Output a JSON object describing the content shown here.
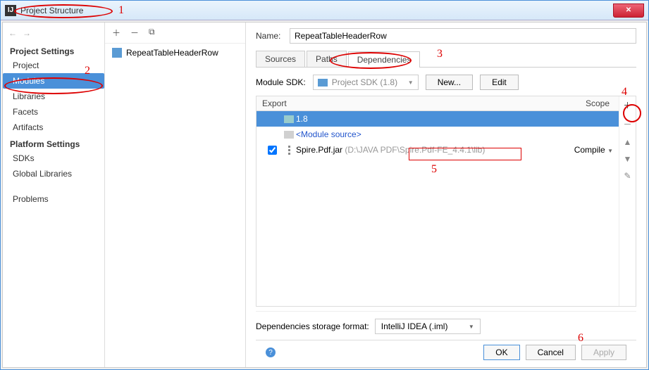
{
  "title": "Project Structure",
  "sidebar": {
    "heading1": "Project Settings",
    "items1": [
      "Project",
      "Modules",
      "Libraries",
      "Facets",
      "Artifacts"
    ],
    "heading2": "Platform Settings",
    "items2": [
      "SDKs",
      "Global Libraries"
    ],
    "footer": "Problems"
  },
  "module_name": "RepeatTableHeaderRow",
  "main": {
    "name_label": "Name:",
    "name_value": "RepeatTableHeaderRow",
    "tabs": [
      "Sources",
      "Paths",
      "Dependencies"
    ],
    "sdk_label": "Module SDK:",
    "sdk_value": "Project SDK (1.8)",
    "btn_new": "New...",
    "btn_edit": "Edit",
    "col_export": "Export",
    "col_scope": "Scope",
    "rows": [
      {
        "kind": "sdk",
        "label": "1.8"
      },
      {
        "kind": "src",
        "label": "<Module source>"
      },
      {
        "kind": "jar",
        "label": "Spire.Pdf.jar",
        "path": " (D:\\JAVA PDF\\Spire.Pdf-FE_4.4.1\\lib)",
        "scope": "Compile"
      }
    ],
    "storage_label": "Dependencies storage format:",
    "storage_value": "IntelliJ IDEA (.iml)"
  },
  "footer": {
    "help": "?",
    "ok": "OK",
    "cancel": "Cancel",
    "apply": "Apply"
  },
  "annotations": {
    "n1": "1",
    "n2": "2",
    "n3": "3",
    "n4": "4",
    "n5": "5",
    "n6": "6"
  }
}
